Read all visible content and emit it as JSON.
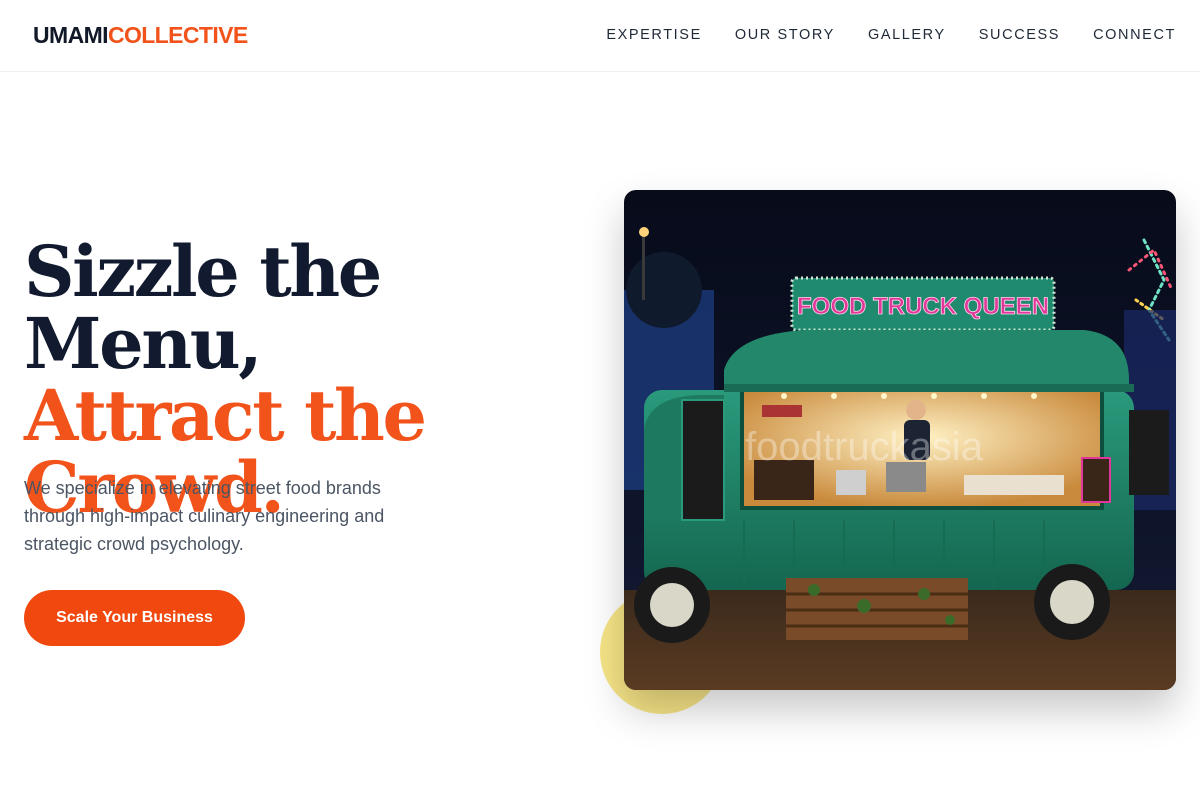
{
  "brand": {
    "logo_part1": "UMAMI",
    "logo_part2": "COLLECTIVE"
  },
  "nav": {
    "items": [
      {
        "label": "EXPERTISE"
      },
      {
        "label": "OUR STORY"
      },
      {
        "label": "GALLERY"
      },
      {
        "label": "SUCCESS"
      },
      {
        "label": "CONNECT"
      }
    ]
  },
  "hero": {
    "headline_line1": "Sizzle the Menu,",
    "headline_line2": "Attract the Crowd.",
    "description": "We specialize in elevating street food brands through high-impact culinary engineering and strategic crowd psychology.",
    "cta_label": "Scale Your Business",
    "image": {
      "sign_text": "FOOD TRUCK QUEEN",
      "watermark": "foodtruckasia"
    }
  },
  "colors": {
    "accent": "#f2531b",
    "cta_bg": "#f0480f",
    "heading_dark": "#111a2e",
    "body_text": "#4b5563",
    "decor_yellow": "#f6e27a",
    "truck_teal": "#1f8a6e"
  }
}
